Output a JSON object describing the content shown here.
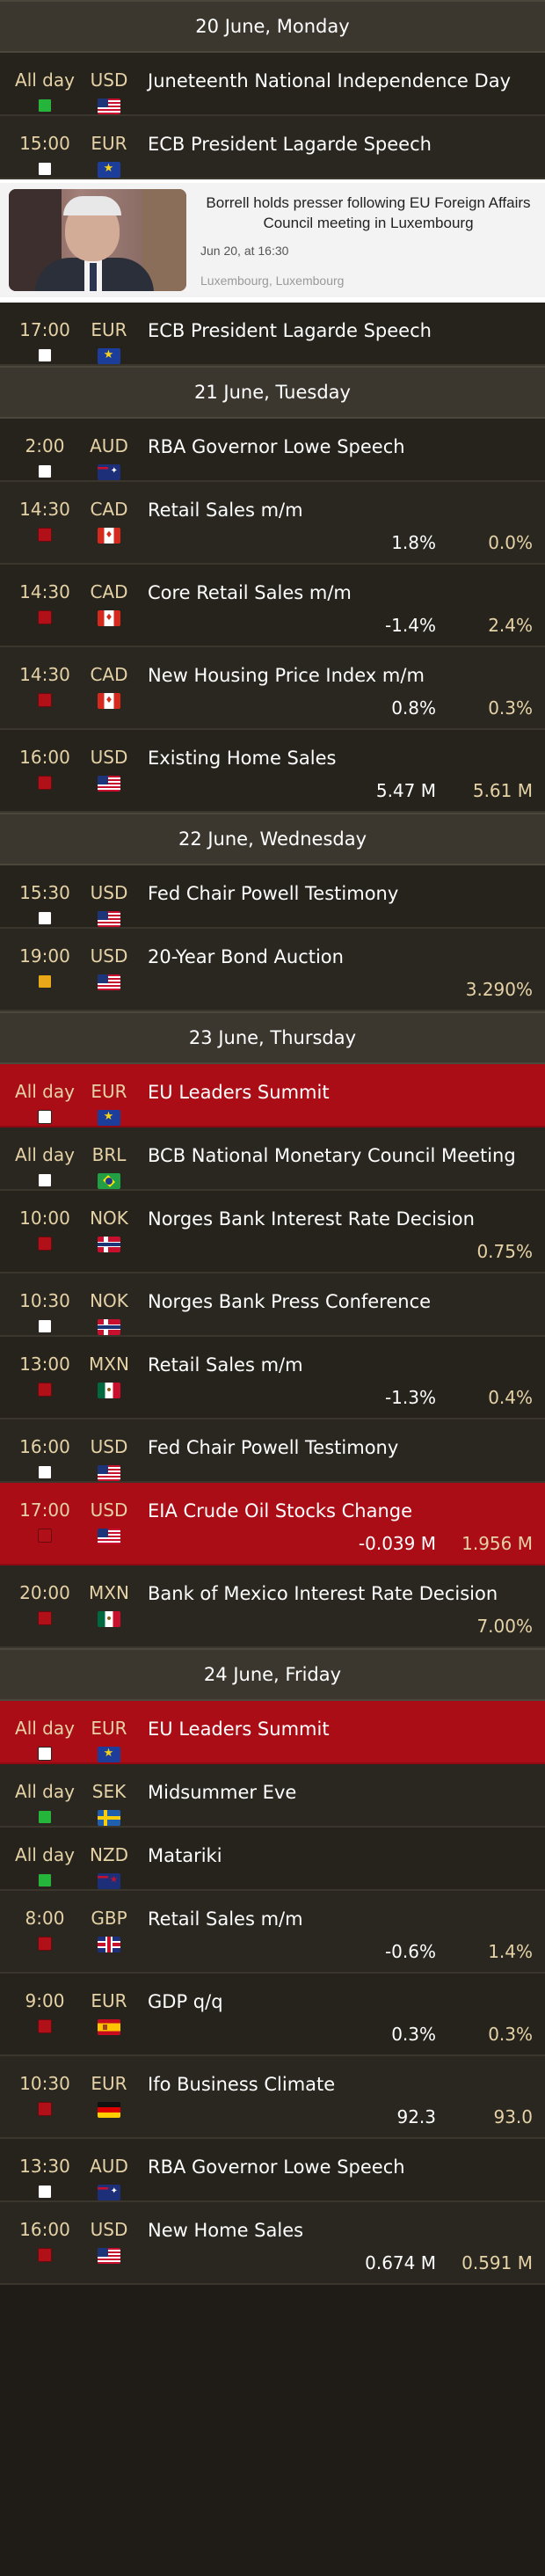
{
  "days": [
    {
      "header": "20 June, Monday",
      "events": [
        {
          "time": "All day",
          "box": "green",
          "currency": "USD",
          "flag": "us",
          "name": "Juneteenth National Independence Day",
          "actual": "",
          "forecast": "",
          "highlight": false
        },
        {
          "time": "15:00",
          "box": "white",
          "currency": "EUR",
          "flag": "eu",
          "name": "ECB President Lagarde Speech",
          "actual": "",
          "forecast": "",
          "highlight": false
        }
      ],
      "news": {
        "title": "Borrell holds presser following EU Foreign Affairs Council meeting in Luxembourg",
        "time": "Jun 20, at 16:30",
        "location": "Luxembourg, Luxembourg"
      },
      "events_after": [
        {
          "time": "17:00",
          "box": "white",
          "currency": "EUR",
          "flag": "eu",
          "name": "ECB President Lagarde Speech",
          "actual": "",
          "forecast": "",
          "highlight": false
        }
      ]
    },
    {
      "header": "21 June, Tuesday",
      "events": [
        {
          "time": "2:00",
          "box": "white",
          "currency": "AUD",
          "flag": "au",
          "name": "RBA Governor Lowe Speech",
          "actual": "",
          "forecast": "",
          "highlight": false
        },
        {
          "time": "14:30",
          "box": "red",
          "currency": "CAD",
          "flag": "ca",
          "name": "Retail Sales m/m",
          "actual": "1.8%",
          "forecast": "0.0%",
          "highlight": false
        },
        {
          "time": "14:30",
          "box": "red",
          "currency": "CAD",
          "flag": "ca",
          "name": "Core Retail Sales m/m",
          "actual": "-1.4%",
          "forecast": "2.4%",
          "highlight": false
        },
        {
          "time": "14:30",
          "box": "red",
          "currency": "CAD",
          "flag": "ca",
          "name": "New Housing Price Index m/m",
          "actual": "0.8%",
          "forecast": "0.3%",
          "highlight": false
        },
        {
          "time": "16:00",
          "box": "red",
          "currency": "USD",
          "flag": "us",
          "name": "Existing Home Sales",
          "actual": "5.47 M",
          "forecast": "5.61 M",
          "highlight": false
        }
      ]
    },
    {
      "header": "22 June, Wednesday",
      "events": [
        {
          "time": "15:30",
          "box": "white",
          "currency": "USD",
          "flag": "us",
          "name": "Fed Chair Powell Testimony",
          "actual": "",
          "forecast": "",
          "highlight": false
        },
        {
          "time": "19:00",
          "box": "orange",
          "currency": "USD",
          "flag": "us",
          "name": "20-Year Bond Auction",
          "actual": "",
          "forecast": "3.290%",
          "highlight": false
        }
      ]
    },
    {
      "header": "23 June, Thursday",
      "events": [
        {
          "time": "All day",
          "box": "white",
          "currency": "EUR",
          "flag": "eu",
          "name": "EU Leaders Summit",
          "actual": "",
          "forecast": "",
          "highlight": true
        },
        {
          "time": "All day",
          "box": "white",
          "currency": "BRL",
          "flag": "br",
          "name": "BCB National Monetary Council Meeting",
          "actual": "",
          "forecast": "",
          "highlight": false
        },
        {
          "time": "10:00",
          "box": "red",
          "currency": "NOK",
          "flag": "no",
          "name": "Norges Bank Interest Rate Decision",
          "actual": "",
          "forecast": "0.75%",
          "highlight": false
        },
        {
          "time": "10:30",
          "box": "white",
          "currency": "NOK",
          "flag": "no",
          "name": "Norges Bank Press Conference",
          "actual": "",
          "forecast": "",
          "highlight": false
        },
        {
          "time": "13:00",
          "box": "red",
          "currency": "MXN",
          "flag": "mx",
          "name": "Retail Sales m/m",
          "actual": "-1.3%",
          "forecast": "0.4%",
          "highlight": false
        },
        {
          "time": "16:00",
          "box": "white",
          "currency": "USD",
          "flag": "us",
          "name": "Fed Chair Powell Testimony",
          "actual": "",
          "forecast": "",
          "highlight": false
        },
        {
          "time": "17:00",
          "box": "red",
          "currency": "USD",
          "flag": "us",
          "name": "EIA Crude Oil Stocks Change",
          "actual": "-0.039 M",
          "forecast": "1.956 M",
          "highlight": true
        },
        {
          "time": "20:00",
          "box": "red",
          "currency": "MXN",
          "flag": "mx",
          "name": "Bank of Mexico Interest Rate Decision",
          "actual": "",
          "forecast": "7.00%",
          "highlight": false
        }
      ]
    },
    {
      "header": "24 June, Friday",
      "events": [
        {
          "time": "All day",
          "box": "white",
          "currency": "EUR",
          "flag": "eu",
          "name": "EU Leaders Summit",
          "actual": "",
          "forecast": "",
          "highlight": true
        },
        {
          "time": "All day",
          "box": "green",
          "currency": "SEK",
          "flag": "se",
          "name": "Midsummer Eve",
          "actual": "",
          "forecast": "",
          "highlight": false
        },
        {
          "time": "All day",
          "box": "green",
          "currency": "NZD",
          "flag": "nz",
          "name": "Matariki",
          "actual": "",
          "forecast": "",
          "highlight": false
        },
        {
          "time": "8:00",
          "box": "red",
          "currency": "GBP",
          "flag": "gb",
          "name": "Retail Sales m/m",
          "actual": "-0.6%",
          "forecast": "1.4%",
          "highlight": false
        },
        {
          "time": "9:00",
          "box": "red",
          "currency": "EUR",
          "flag": "es",
          "name": "GDP q/q",
          "actual": "0.3%",
          "forecast": "0.3%",
          "highlight": false
        },
        {
          "time": "10:30",
          "box": "red",
          "currency": "EUR",
          "flag": "de",
          "name": "Ifo Business Climate",
          "actual": "92.3",
          "forecast": "93.0",
          "highlight": false
        },
        {
          "time": "13:30",
          "box": "white",
          "currency": "AUD",
          "flag": "au",
          "name": "RBA Governor Lowe Speech",
          "actual": "",
          "forecast": "",
          "highlight": false
        },
        {
          "time": "16:00",
          "box": "red",
          "currency": "USD",
          "flag": "us",
          "name": "New Home Sales",
          "actual": "0.674 M",
          "forecast": "0.591 M",
          "highlight": false
        }
      ]
    }
  ]
}
